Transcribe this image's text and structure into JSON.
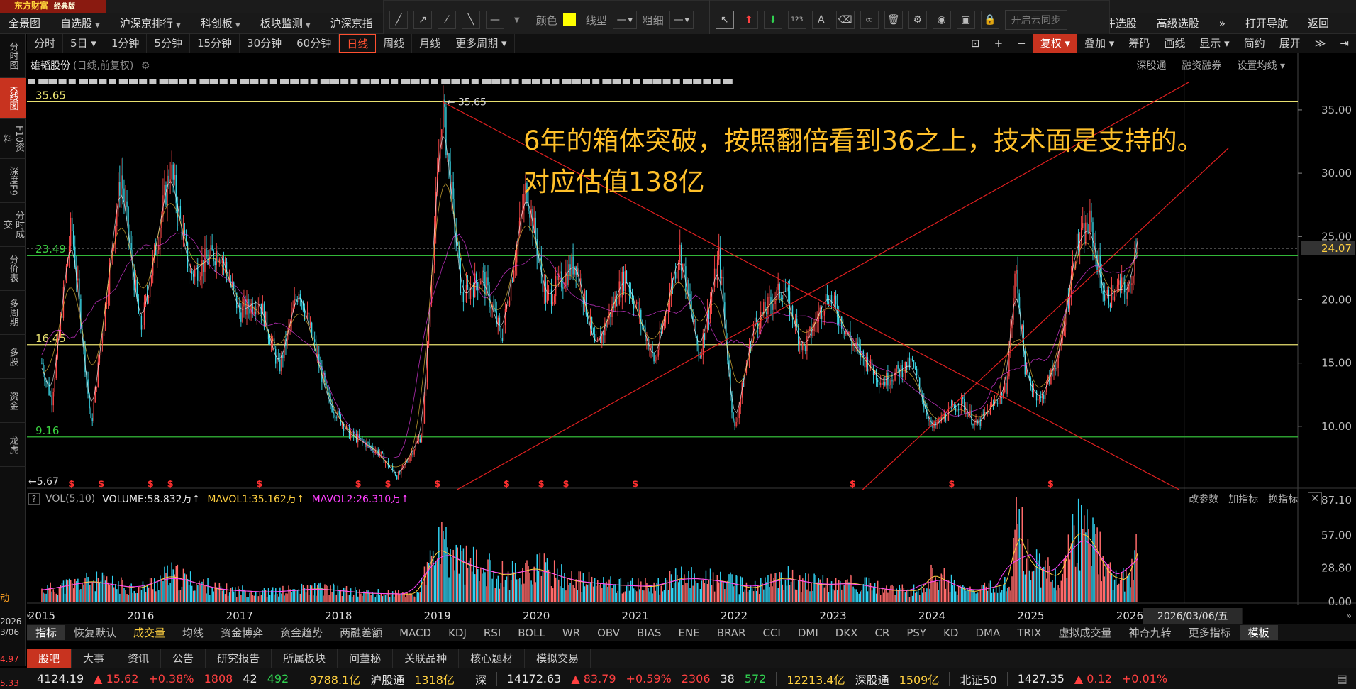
{
  "app": {
    "name": "东方财富",
    "edition": "经典版"
  },
  "menu": [
    {
      "label": "全景图",
      "caret": false
    },
    {
      "label": "自选股",
      "caret": true
    },
    {
      "label": "沪深京排行",
      "caret": true
    },
    {
      "label": "科创板",
      "caret": true
    },
    {
      "label": "板块监测",
      "caret": true
    },
    {
      "label": "沪深京指",
      "caret": false
    }
  ],
  "menu_right": [
    "条件选股",
    "高级选股",
    "»",
    "打开导航",
    "返回"
  ],
  "drawbar": {
    "color_label": "颜色",
    "color": "#ffff00",
    "line_type_label": "线型",
    "line_type_value": "—",
    "thickness_label": "粗细",
    "thickness_value": "—",
    "cloud_sync": "开启云同步"
  },
  "leftrail": [
    {
      "label": "分时图",
      "active": false
    },
    {
      "label": "K线图",
      "active": true
    },
    {
      "label": "F10资料",
      "active": false
    },
    {
      "label": "深度F9",
      "active": false
    },
    {
      "label": "分时成交",
      "active": false
    },
    {
      "label": "分价表",
      "active": false
    },
    {
      "label": "多周期",
      "active": false
    },
    {
      "label": "多股",
      "active": false
    },
    {
      "label": "资金",
      "active": false
    },
    {
      "label": "龙虎",
      "active": false
    }
  ],
  "periods": [
    {
      "label": "分时",
      "active": false
    },
    {
      "label": "5日 ▾",
      "active": false
    },
    {
      "label": "1分钟",
      "active": false
    },
    {
      "label": "5分钟",
      "active": false
    },
    {
      "label": "15分钟",
      "active": false
    },
    {
      "label": "30分钟",
      "active": false
    },
    {
      "label": "60分钟",
      "active": false
    },
    {
      "label": "日线",
      "active": true
    },
    {
      "label": "周线",
      "active": false
    },
    {
      "label": "月线",
      "active": false
    },
    {
      "label": "更多周期 ▾",
      "active": false
    }
  ],
  "right_tools": [
    {
      "label": "复权 ▾",
      "red": true
    },
    {
      "label": "叠加 ▾",
      "red": false
    },
    {
      "label": "筹码",
      "red": false
    },
    {
      "label": "画线",
      "red": false
    },
    {
      "label": "显示 ▾",
      "red": false
    },
    {
      "label": "简约",
      "red": false
    },
    {
      "label": "展开",
      "red": false
    }
  ],
  "stock": {
    "name": "雄韬股份",
    "params": "(日线,前复权)"
  },
  "chart_links": [
    "深股通",
    "融资融券",
    "设置均线 ▾"
  ],
  "annotation": {
    "line1": "6年的箱体突破，按照翻倍看到36之上，技术面是支持的。",
    "line2": "对应估值138亿"
  },
  "vol_info": {
    "label": "VOL(5,10)",
    "volume": "VOLUME:58.832万↑",
    "mavol1": "MAVOL1:35.162万↑",
    "mavol2": "MAVOL2:26.310万↑"
  },
  "vol_actions": [
    "改参数",
    "加指标",
    "换指标"
  ],
  "indicator_tabs": [
    {
      "label": "指标",
      "active": true,
      "hl": false
    },
    {
      "label": "恢复默认",
      "active": false,
      "hl": false
    },
    {
      "label": "成交量",
      "active": false,
      "hl": true
    },
    {
      "label": "均线",
      "active": false,
      "hl": false
    },
    {
      "label": "资金博弈",
      "active": false,
      "hl": false
    },
    {
      "label": "资金趋势",
      "active": false,
      "hl": false
    },
    {
      "label": "两融差额",
      "active": false,
      "hl": false
    },
    {
      "label": "MACD",
      "active": false,
      "hl": false
    },
    {
      "label": "KDJ",
      "active": false,
      "hl": false
    },
    {
      "label": "RSI",
      "active": false,
      "hl": false
    },
    {
      "label": "BOLL",
      "active": false,
      "hl": false
    },
    {
      "label": "WR",
      "active": false,
      "hl": false
    },
    {
      "label": "OBV",
      "active": false,
      "hl": false
    },
    {
      "label": "BIAS",
      "active": false,
      "hl": false
    },
    {
      "label": "ENE",
      "active": false,
      "hl": false
    },
    {
      "label": "BRAR",
      "active": false,
      "hl": false
    },
    {
      "label": "CCI",
      "active": false,
      "hl": false
    },
    {
      "label": "DMI",
      "active": false,
      "hl": false
    },
    {
      "label": "DKX",
      "active": false,
      "hl": false
    },
    {
      "label": "CR",
      "active": false,
      "hl": false
    },
    {
      "label": "PSY",
      "active": false,
      "hl": false
    },
    {
      "label": "KD",
      "active": false,
      "hl": false
    },
    {
      "label": "DMA",
      "active": false,
      "hl": false
    },
    {
      "label": "TRIX",
      "active": false,
      "hl": false
    },
    {
      "label": "虚拟成交量",
      "active": false,
      "hl": false
    },
    {
      "label": "神奇九转",
      "active": false,
      "hl": false
    },
    {
      "label": "更多指标",
      "active": false,
      "hl": false
    },
    {
      "label": "模板",
      "active": true,
      "hl": false
    }
  ],
  "info_tabs": [
    {
      "label": "股吧",
      "active": true
    },
    {
      "label": "大事",
      "active": false
    },
    {
      "label": "资讯",
      "active": false
    },
    {
      "label": "公告",
      "active": false
    },
    {
      "label": "研究报告",
      "active": false
    },
    {
      "label": "所属板块",
      "active": false
    },
    {
      "label": "问董秘",
      "active": false
    },
    {
      "label": "关联品种",
      "active": false
    },
    {
      "label": "核心题材",
      "active": false
    },
    {
      "label": "模拟交易",
      "active": false
    }
  ],
  "status": {
    "sh_index": "4124.19",
    "sh_change": "▲ 15.62",
    "sh_pct": "+0.38%",
    "sh_up": "1808",
    "sh_flat": "42",
    "sh_down": "492",
    "sh_amount": "9788.1亿",
    "hgt_label": "沪股通",
    "hgt_value": "1318亿",
    "sz_label": "深",
    "sz_index": "14172.63",
    "sz_change": "▲ 83.79",
    "sz_pct": "+0.59%",
    "sz_up": "2306",
    "sz_flat": "38",
    "sz_down": "572",
    "sz_amount": "12213.4亿",
    "sgt_label": "深股通",
    "sgt_value": "1509亿",
    "bz_label": "北证50",
    "bz_index": "1427.35",
    "bz_change": "▲ 0.12",
    "bz_pct": "+0.01%"
  },
  "edge_fragments": {
    "left_top": "动",
    "year": "2026",
    "date": "3/06",
    "p1": "4.97",
    "p2": "5.33"
  },
  "chart_data": {
    "type": "candlestick",
    "title": "雄韬股份 (日线,前复权)",
    "x_labels": [
      "2015",
      "2016",
      "2017",
      "2018",
      "2019",
      "2020",
      "2021",
      "2022",
      "2023",
      "2024",
      "2025",
      "2026"
    ],
    "y_ticks": [
      35.0,
      30.0,
      25.0,
      20.0,
      15.0,
      10.0
    ],
    "y_range": [
      5.0,
      37.8
    ],
    "horizontal_levels": [
      {
        "value": 35.65,
        "label": "35.65",
        "color": "#e8e070"
      },
      {
        "value": 23.49,
        "label": "23.49",
        "color": "#3ad040"
      },
      {
        "value": 16.45,
        "label": "16.45",
        "color": "#e8e070"
      },
      {
        "value": 9.16,
        "label": "9.16",
        "color": "#3ad040"
      }
    ],
    "markers": {
      "high": "35.65",
      "low": "5.67"
    },
    "last_price": "24.07",
    "cursor_date": "2026/03/06/五",
    "price_path_key_points": [
      {
        "x": 2015.0,
        "y": 15.0
      },
      {
        "x": 2015.1,
        "y": 12.0
      },
      {
        "x": 2015.3,
        "y": 26.0
      },
      {
        "x": 2015.5,
        "y": 10.0
      },
      {
        "x": 2015.8,
        "y": 30.0
      },
      {
        "x": 2016.0,
        "y": 17.5
      },
      {
        "x": 2016.3,
        "y": 30.5
      },
      {
        "x": 2016.5,
        "y": 22.0
      },
      {
        "x": 2016.8,
        "y": 24.0
      },
      {
        "x": 2017.0,
        "y": 19.0
      },
      {
        "x": 2017.2,
        "y": 20.0
      },
      {
        "x": 2017.4,
        "y": 14.5
      },
      {
        "x": 2017.6,
        "y": 21.0
      },
      {
        "x": 2017.9,
        "y": 12.0
      },
      {
        "x": 2018.1,
        "y": 9.5
      },
      {
        "x": 2018.4,
        "y": 8.0
      },
      {
        "x": 2018.6,
        "y": 6.0
      },
      {
        "x": 2018.85,
        "y": 9.5
      },
      {
        "x": 2018.95,
        "y": 23.0
      },
      {
        "x": 2019.05,
        "y": 35.6
      },
      {
        "x": 2019.25,
        "y": 20.0
      },
      {
        "x": 2019.45,
        "y": 22.0
      },
      {
        "x": 2019.65,
        "y": 17.0
      },
      {
        "x": 2019.9,
        "y": 29.0
      },
      {
        "x": 2020.1,
        "y": 20.0
      },
      {
        "x": 2020.4,
        "y": 23.0
      },
      {
        "x": 2020.6,
        "y": 16.0
      },
      {
        "x": 2020.9,
        "y": 22.0
      },
      {
        "x": 2021.2,
        "y": 15.0
      },
      {
        "x": 2021.45,
        "y": 24.0
      },
      {
        "x": 2021.65,
        "y": 15.5
      },
      {
        "x": 2021.85,
        "y": 23.5
      },
      {
        "x": 2022.0,
        "y": 9.5
      },
      {
        "x": 2022.2,
        "y": 18.0
      },
      {
        "x": 2022.5,
        "y": 21.0
      },
      {
        "x": 2022.7,
        "y": 16.0
      },
      {
        "x": 2022.95,
        "y": 20.5
      },
      {
        "x": 2023.2,
        "y": 16.5
      },
      {
        "x": 2023.5,
        "y": 13.5
      },
      {
        "x": 2023.8,
        "y": 15.0
      },
      {
        "x": 2024.0,
        "y": 9.8
      },
      {
        "x": 2024.3,
        "y": 12.0
      },
      {
        "x": 2024.45,
        "y": 10.0
      },
      {
        "x": 2024.75,
        "y": 13.0
      },
      {
        "x": 2024.85,
        "y": 22.5
      },
      {
        "x": 2024.95,
        "y": 14.0
      },
      {
        "x": 2025.1,
        "y": 12.0
      },
      {
        "x": 2025.3,
        "y": 16.0
      },
      {
        "x": 2025.45,
        "y": 24.0
      },
      {
        "x": 2025.6,
        "y": 26.0
      },
      {
        "x": 2025.75,
        "y": 20.0
      },
      {
        "x": 2025.9,
        "y": 21.0
      },
      {
        "x": 2026.0,
        "y": 20.5
      },
      {
        "x": 2026.08,
        "y": 25.5
      }
    ],
    "trend_lines": [
      {
        "from": {
          "x": 2019.05,
          "y": 35.65
        },
        "to": {
          "x": 2026.5,
          "y": 5.0
        },
        "color": "#e02020"
      },
      {
        "from": {
          "x": 2019.2,
          "y": 5.0
        },
        "to": {
          "x": 2026.6,
          "y": 37.2
        },
        "color": "#e02020"
      },
      {
        "from": {
          "x": 2023.3,
          "y": 5.0
        },
        "to": {
          "x": 2027.0,
          "y": 32.0
        },
        "color": "#e02020"
      }
    ],
    "volume": {
      "y_ticks": [
        87.1,
        57.0,
        28.8,
        0.0
      ],
      "y_range": [
        0,
        90
      ],
      "series": [
        {
          "name": "VOLUME",
          "color": "#30d0f0"
        },
        {
          "name": "MAVOL1",
          "color": "#ffd040"
        },
        {
          "name": "MAVOL2",
          "color": "#ff40ff"
        }
      ],
      "profile": [
        {
          "x": 2015.0,
          "v": 12
        },
        {
          "x": 2015.5,
          "v": 22
        },
        {
          "x": 2016.0,
          "v": 14
        },
        {
          "x": 2016.3,
          "v": 28
        },
        {
          "x": 2016.8,
          "v": 13
        },
        {
          "x": 2017.3,
          "v": 10
        },
        {
          "x": 2017.8,
          "v": 14
        },
        {
          "x": 2018.3,
          "v": 9
        },
        {
          "x": 2018.8,
          "v": 8
        },
        {
          "x": 2019.0,
          "v": 58
        },
        {
          "x": 2019.3,
          "v": 40
        },
        {
          "x": 2019.7,
          "v": 28
        },
        {
          "x": 2020.0,
          "v": 36
        },
        {
          "x": 2020.4,
          "v": 22
        },
        {
          "x": 2020.8,
          "v": 18
        },
        {
          "x": 2021.2,
          "v": 16
        },
        {
          "x": 2021.5,
          "v": 26
        },
        {
          "x": 2021.9,
          "v": 22
        },
        {
          "x": 2022.2,
          "v": 14
        },
        {
          "x": 2022.5,
          "v": 26
        },
        {
          "x": 2022.9,
          "v": 18
        },
        {
          "x": 2023.2,
          "v": 20
        },
        {
          "x": 2023.6,
          "v": 12
        },
        {
          "x": 2023.9,
          "v": 12
        },
        {
          "x": 2024.0,
          "v": 30
        },
        {
          "x": 2024.4,
          "v": 10
        },
        {
          "x": 2024.8,
          "v": 20
        },
        {
          "x": 2024.85,
          "v": 85
        },
        {
          "x": 2025.0,
          "v": 40
        },
        {
          "x": 2025.3,
          "v": 25
        },
        {
          "x": 2025.45,
          "v": 75
        },
        {
          "x": 2025.6,
          "v": 70
        },
        {
          "x": 2025.8,
          "v": 28
        },
        {
          "x": 2026.0,
          "v": 22
        },
        {
          "x": 2026.08,
          "v": 60
        }
      ]
    },
    "x_domain": [
      2014.85,
      2027.7
    ]
  }
}
